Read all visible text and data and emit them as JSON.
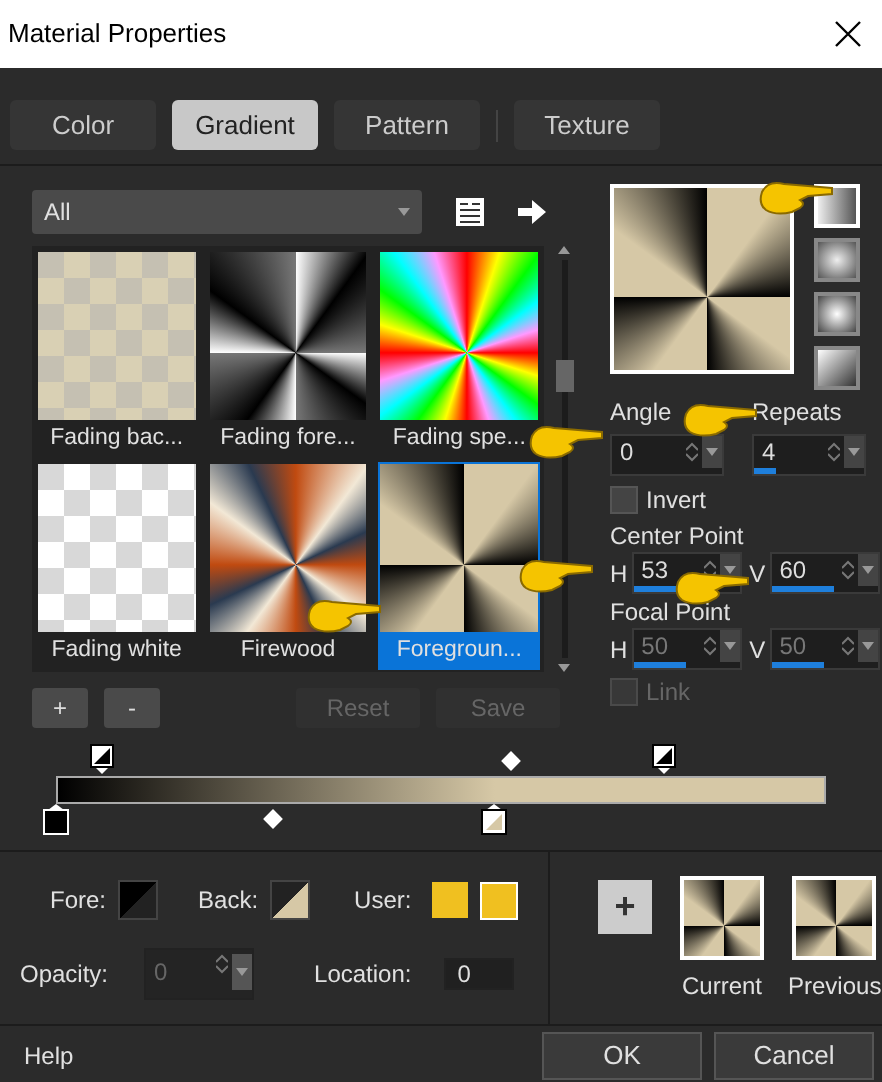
{
  "window": {
    "title": "Material Properties"
  },
  "tabs": [
    {
      "label": "Color",
      "selected": false
    },
    {
      "label": "Gradient",
      "selected": true
    },
    {
      "label": "Pattern",
      "selected": false
    },
    {
      "label": "Texture",
      "selected": false
    }
  ],
  "library": {
    "category": "All",
    "swatches": [
      {
        "label": "Fading bac...",
        "kind": "fade-beige",
        "selected": false
      },
      {
        "label": "Fading fore...",
        "kind": "fade-gray",
        "selected": false
      },
      {
        "label": "Fading spe...",
        "kind": "spectrum",
        "selected": false
      },
      {
        "label": "Fading white",
        "kind": "fade-white",
        "selected": false
      },
      {
        "label": "Firewood",
        "kind": "firewood",
        "selected": false
      },
      {
        "label": "Foregroun...",
        "kind": "foreground",
        "selected": true
      }
    ],
    "buttons": [
      {
        "label": "+",
        "disabled": false
      },
      {
        "label": "-",
        "disabled": false
      },
      {
        "label": "Reset",
        "disabled": true
      },
      {
        "label": "Save",
        "disabled": true
      }
    ]
  },
  "style_buttons": [
    {
      "selected": true
    },
    {
      "selected": false
    },
    {
      "selected": false
    },
    {
      "selected": false
    }
  ],
  "angle": {
    "label": "Angle",
    "value": "0"
  },
  "repeats": {
    "label": "Repeats",
    "value": "4",
    "level": 0.2
  },
  "invert": {
    "label": "Invert",
    "checked": false
  },
  "center_point": {
    "label": "Center Point",
    "h_label": "H",
    "h": {
      "value": "53",
      "level": 0.53
    },
    "v_label": "V",
    "v": {
      "value": "60",
      "level": 0.6
    },
    "disabled": false
  },
  "focal_point": {
    "label": "Focal Point",
    "h_label": "H",
    "h": {
      "value": "50",
      "level": 0.5
    },
    "v_label": "V",
    "v": {
      "value": "50",
      "level": 0.5
    },
    "disabled": true
  },
  "link": {
    "label": "Link",
    "checked": false,
    "disabled": true
  },
  "gradient_editor": {
    "opacity_stops": [
      {
        "level": 0.06
      },
      {
        "level": 0.79
      }
    ],
    "opacity_midpoints": [
      {
        "level": 0.59
      }
    ],
    "color_stops": [
      {
        "level": 0,
        "color": "#000000",
        "selected": true
      },
      {
        "level": 0.57,
        "color": "#d6c8a6",
        "selected": false
      }
    ],
    "color_midpoints": [
      {
        "level": 0.28
      }
    ]
  },
  "fore": {
    "label": "Fore:"
  },
  "back": {
    "label": "Back:"
  },
  "user": {
    "label": "User:"
  },
  "opacity": {
    "label": "Opacity:",
    "value": "0",
    "disabled": true
  },
  "location": {
    "label": "Location:",
    "value": "0"
  },
  "add_button": {
    "label": "+"
  },
  "current": {
    "label": "Current"
  },
  "previous": {
    "label": "Previous"
  },
  "footer": {
    "help": "Help",
    "ok": "OK",
    "cancel": "Cancel"
  }
}
